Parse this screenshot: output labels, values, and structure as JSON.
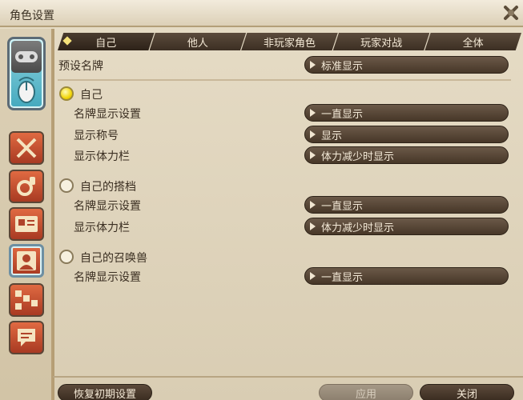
{
  "window": {
    "title": "角色设置"
  },
  "tabs": [
    {
      "label": "自己",
      "active": true
    },
    {
      "label": "他人",
      "active": false
    },
    {
      "label": "非玩家角色",
      "active": false
    },
    {
      "label": "玩家对战",
      "active": false
    },
    {
      "label": "全体",
      "active": false
    }
  ],
  "preset": {
    "label": "预设名牌",
    "value": "标准显示"
  },
  "sections": [
    {
      "title": "自己",
      "selected": true,
      "rows": [
        {
          "label": "名牌显示设置",
          "value": "一直显示"
        },
        {
          "label": "显示称号",
          "value": "显示"
        },
        {
          "label": "显示体力栏",
          "value": "体力减少时显示"
        }
      ]
    },
    {
      "title": "自己的搭档",
      "selected": false,
      "rows": [
        {
          "label": "名牌显示设置",
          "value": "一直显示"
        },
        {
          "label": "显示体力栏",
          "value": "体力减少时显示"
        }
      ]
    },
    {
      "title": "自己的召唤兽",
      "selected": false,
      "rows": [
        {
          "label": "名牌显示设置",
          "value": "一直显示"
        }
      ]
    }
  ],
  "sidebar": {
    "categories": [
      "gamepad-icon",
      "mouse-icon",
      "crossed-swords-icon",
      "gear-potion-icon",
      "id-card-icon",
      "portrait-icon",
      "hud-layout-icon",
      "chat-bubble-icon"
    ]
  },
  "footer": {
    "reset_label": "恢复初期设置",
    "apply_label": "应用",
    "close_label": "关闭"
  },
  "colors": {
    "panel": "#e0d5bd",
    "tab_dark": "#3c2f23",
    "radio_on": "#f2d60b"
  }
}
